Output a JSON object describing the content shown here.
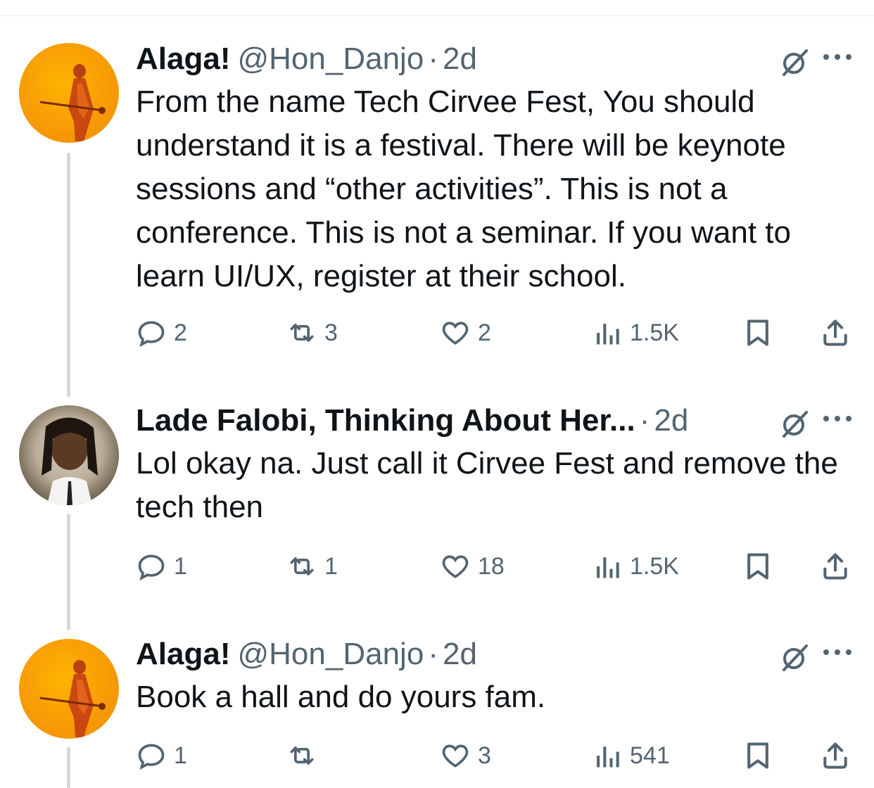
{
  "tweets": [
    {
      "name": "Alaga!",
      "handle": "@Hon_Danjo",
      "separator": "·",
      "time": "2d",
      "text": "From the name Tech Cirvee Fest, You should understand it is a festival. There will be keynote sessions and “other activities”. This is not a conference. This is not a seminar. If you want to learn UI/UX, register at their school.",
      "replies": "2",
      "reposts": "3",
      "likes": "2",
      "views": "1.5K"
    },
    {
      "name": "Lade Falobi, Thinking About Her...",
      "handle": "",
      "separator": "·",
      "time": "2d",
      "text": "Lol okay na. Just call it Cirvee Fest and remove the tech then",
      "replies": "1",
      "reposts": "1",
      "likes": "18",
      "views": "1.5K"
    },
    {
      "name": "Alaga!",
      "handle": "@Hon_Danjo",
      "separator": "·",
      "time": "2d",
      "text": "Book a hall and do yours fam.",
      "replies": "1",
      "reposts": "",
      "likes": "3",
      "views": "541"
    }
  ],
  "icons": {
    "reply": "reply-icon",
    "repost": "repost-icon",
    "like": "like-icon",
    "views": "views-icon",
    "bookmark": "bookmark-icon",
    "share": "share-icon",
    "grok": "grok-icon",
    "more": "more-icon"
  },
  "colors": {
    "text": "#0f1419",
    "secondary": "#536471",
    "thread_line": "#cfd9de",
    "avatar_orange": "#f79a07"
  }
}
